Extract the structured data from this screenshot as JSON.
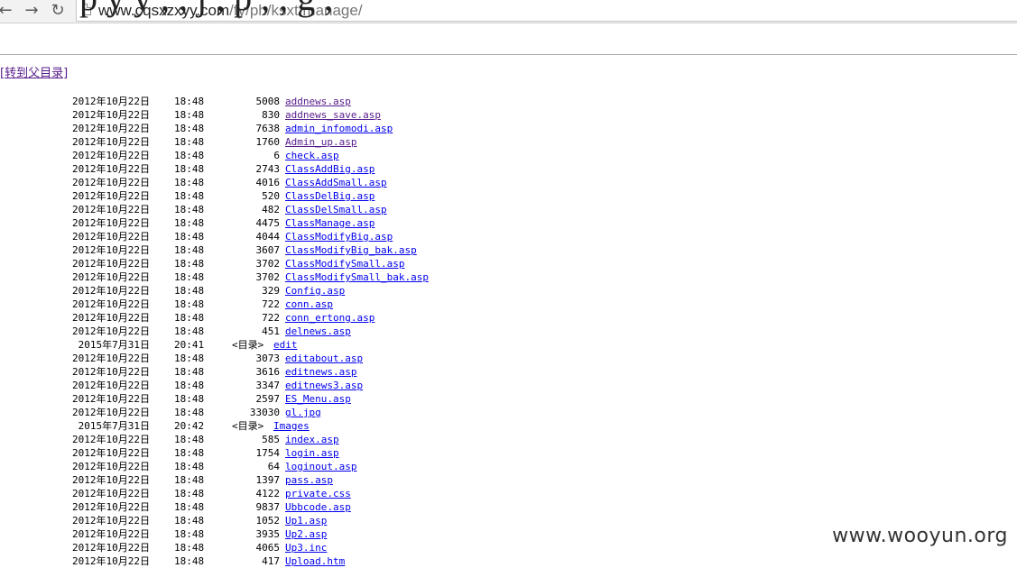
{
  "browser": {
    "back_glyph": "←",
    "forward_glyph": "→",
    "reload_glyph": "↻",
    "url_host": "www.cqsxzxyy.com",
    "url_path": "/fy/ph/ksxt/manage/"
  },
  "page": {
    "cut_heading": "p    y y      ,   , j ,  p ,       ,       g ,",
    "parent_link": "[转到父目录]",
    "dir_tag": "<目录>"
  },
  "entries": [
    {
      "date": "2012年10月22日",
      "time": "18:48",
      "size": "5008",
      "name": "addnews.asp",
      "visited": true
    },
    {
      "date": "2012年10月22日",
      "time": "18:48",
      "size": "830",
      "name": "addnews_save.asp",
      "visited": true
    },
    {
      "date": "2012年10月22日",
      "time": "18:48",
      "size": "7638",
      "name": "admin_infomodi.asp",
      "visited": false
    },
    {
      "date": "2012年10月22日",
      "time": "18:48",
      "size": "1760",
      "name": "Admin_up.asp",
      "visited": true
    },
    {
      "date": "2012年10月22日",
      "time": "18:48",
      "size": "6",
      "name": "check.asp",
      "visited": false
    },
    {
      "date": "2012年10月22日",
      "time": "18:48",
      "size": "2743",
      "name": "ClassAddBig.asp",
      "visited": false
    },
    {
      "date": "2012年10月22日",
      "time": "18:48",
      "size": "4016",
      "name": "ClassAddSmall.asp",
      "visited": false
    },
    {
      "date": "2012年10月22日",
      "time": "18:48",
      "size": "520",
      "name": "ClassDelBig.asp",
      "visited": false
    },
    {
      "date": "2012年10月22日",
      "time": "18:48",
      "size": "482",
      "name": "ClassDelSmall.asp",
      "visited": false
    },
    {
      "date": "2012年10月22日",
      "time": "18:48",
      "size": "4475",
      "name": "ClassManage.asp",
      "visited": false
    },
    {
      "date": "2012年10月22日",
      "time": "18:48",
      "size": "4044",
      "name": "ClassModifyBig.asp",
      "visited": false
    },
    {
      "date": "2012年10月22日",
      "time": "18:48",
      "size": "3607",
      "name": "ClassModifyBig_bak.asp",
      "visited": false
    },
    {
      "date": "2012年10月22日",
      "time": "18:48",
      "size": "3702",
      "name": "ClassModifySmall.asp",
      "visited": false
    },
    {
      "date": "2012年10月22日",
      "time": "18:48",
      "size": "3702",
      "name": "ClassModifySmall_bak.asp",
      "visited": false
    },
    {
      "date": "2012年10月22日",
      "time": "18:48",
      "size": "329",
      "name": "Config.asp",
      "visited": false
    },
    {
      "date": "2012年10月22日",
      "time": "18:48",
      "size": "722",
      "name": "conn.asp",
      "visited": false
    },
    {
      "date": "2012年10月22日",
      "time": "18:48",
      "size": "722",
      "name": "conn_ertong.asp",
      "visited": false
    },
    {
      "date": "2012年10月22日",
      "time": "18:48",
      "size": "451",
      "name": "delnews.asp",
      "visited": false
    },
    {
      "date": "2015年7月31日",
      "time": "20:41",
      "size": "",
      "name": "edit",
      "dir": true,
      "visited": false
    },
    {
      "date": "2012年10月22日",
      "time": "18:48",
      "size": "3073",
      "name": "editabout.asp",
      "visited": false
    },
    {
      "date": "2012年10月22日",
      "time": "18:48",
      "size": "3616",
      "name": "editnews.asp",
      "visited": false
    },
    {
      "date": "2012年10月22日",
      "time": "18:48",
      "size": "3347",
      "name": "editnews3.asp",
      "visited": false
    },
    {
      "date": "2012年10月22日",
      "time": "18:48",
      "size": "2597",
      "name": "ES_Menu.asp",
      "visited": false
    },
    {
      "date": "2012年10月22日",
      "time": "18:48",
      "size": "33030",
      "name": "gl.jpg",
      "visited": false
    },
    {
      "date": "2015年7月31日",
      "time": "20:42",
      "size": "",
      "name": "Images",
      "dir": true,
      "visited": false
    },
    {
      "date": "2012年10月22日",
      "time": "18:48",
      "size": "585",
      "name": "index.asp",
      "visited": false
    },
    {
      "date": "2012年10月22日",
      "time": "18:48",
      "size": "1754",
      "name": "login.asp",
      "visited": false
    },
    {
      "date": "2012年10月22日",
      "time": "18:48",
      "size": "64",
      "name": "loginout.asp",
      "visited": false
    },
    {
      "date": "2012年10月22日",
      "time": "18:48",
      "size": "1397",
      "name": "pass.asp",
      "visited": false
    },
    {
      "date": "2012年10月22日",
      "time": "18:48",
      "size": "4122",
      "name": "private.css",
      "visited": false
    },
    {
      "date": "2012年10月22日",
      "time": "18:48",
      "size": "9837",
      "name": "Ubbcode.asp",
      "visited": false
    },
    {
      "date": "2012年10月22日",
      "time": "18:48",
      "size": "1052",
      "name": "Up1.asp",
      "visited": false
    },
    {
      "date": "2012年10月22日",
      "time": "18:48",
      "size": "3935",
      "name": "Up2.asp",
      "visited": false
    },
    {
      "date": "2012年10月22日",
      "time": "18:48",
      "size": "4065",
      "name": "Up3.inc",
      "visited": false
    },
    {
      "date": "2012年10月22日",
      "time": "18:48",
      "size": "417",
      "name": "Upload.htm",
      "visited": false
    }
  ],
  "watermark": "www.wooyun.org",
  "colors": {
    "link": "#0000ee",
    "visited_link": "#551a8b"
  }
}
